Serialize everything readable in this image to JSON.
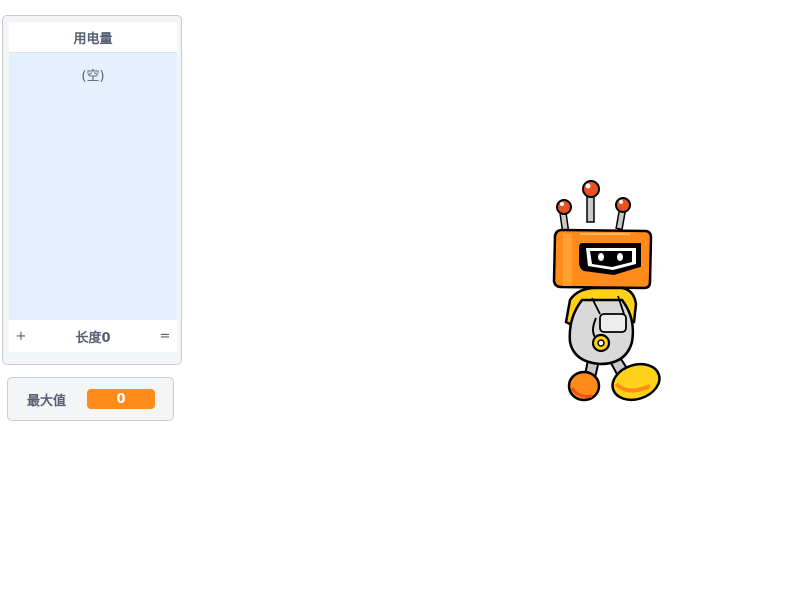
{
  "list_monitor": {
    "title": "用电量",
    "empty_text": "(空)",
    "add_symbol": "+",
    "length_text": "长度0",
    "resize_symbol": "="
  },
  "variable_monitor": {
    "label": "最大值",
    "value": "0",
    "value_color": "#ff8c1a"
  },
  "sprite": {
    "icon": "robot-sprite"
  }
}
